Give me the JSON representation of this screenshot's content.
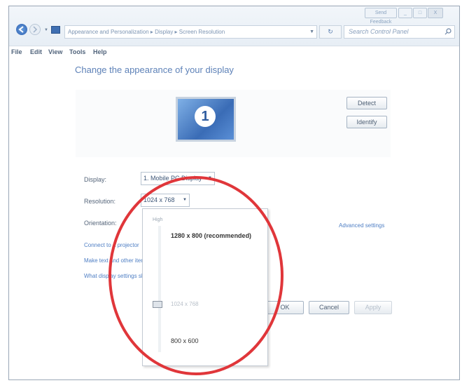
{
  "window": {
    "buttons": [
      "Send Feedback",
      "_",
      "□",
      "X"
    ],
    "address": "Appearance and Personalization ▸ Display ▸ Screen Resolution",
    "search_placeholder": "Search Control Panel",
    "refresh_icon": "refresh-icon"
  },
  "menu": [
    "File",
    "Edit",
    "View",
    "Tools",
    "Help"
  ],
  "content": {
    "heading": "Change the appearance of your display",
    "monitor_number": "1",
    "detect": "Detect",
    "identify": "Identify",
    "display_label": "Display:",
    "display_value": "1. Mobile PC Display",
    "resolution_label": "Resolution:",
    "resolution_value": "1024 x 768",
    "orientation_label": "Orientation:",
    "advanced": "Advanced settings",
    "links": [
      "Connect to a projector",
      "Make text and other items larger or smaller",
      "What display settings should I choose?"
    ],
    "ok": "OK",
    "cancel": "Cancel",
    "apply": "Apply"
  },
  "dropdown": {
    "high": "High",
    "option_top": "1280 x 800 (recommended)",
    "option_selected": "1024 x 768",
    "option_bottom": "800 x 600"
  },
  "annotation": {
    "circle_color": "#e0363a"
  }
}
